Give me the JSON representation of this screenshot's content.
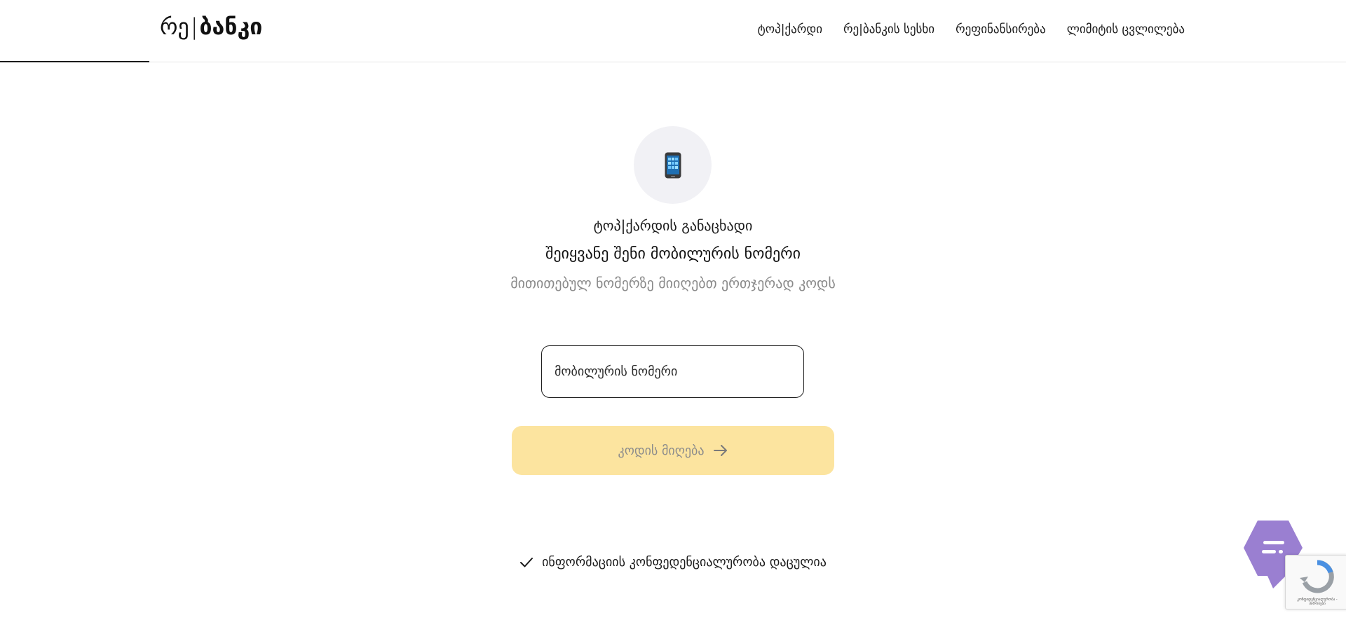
{
  "header": {
    "logo": {
      "light": "რე",
      "separator": "|",
      "bold": "ბანკი"
    },
    "nav": [
      {
        "label": "ტოპ|ქარდი"
      },
      {
        "label": "რე|ბანკის სესხი"
      },
      {
        "label": "რეფინანსირება"
      },
      {
        "label": "ლიმიტის ცვლილება"
      }
    ]
  },
  "main": {
    "icon": "mobile-phone-icon",
    "heading_1": "ტოპ|ქარდის განაცხადი",
    "heading_2": "შეიყვანე შენი მობილურის ნომერი",
    "subtitle": "მითითებულ ნომერზე მიიღებთ ერთჯერად კოდს",
    "phone_input": {
      "placeholder": "მობილურის ნომერი",
      "value": ""
    },
    "submit_button": {
      "label": "კოდის მიღება"
    },
    "privacy_note": "ინფორმაციის კონფედენციალურობა დაცულია"
  },
  "widgets": {
    "recaptcha_text": "კონფიდენციალურობა - პირობები"
  },
  "colors": {
    "button_bg": "#fce49f",
    "chat_bubble": "#9a7fd1",
    "icon_circle": "#f1f1f5"
  }
}
